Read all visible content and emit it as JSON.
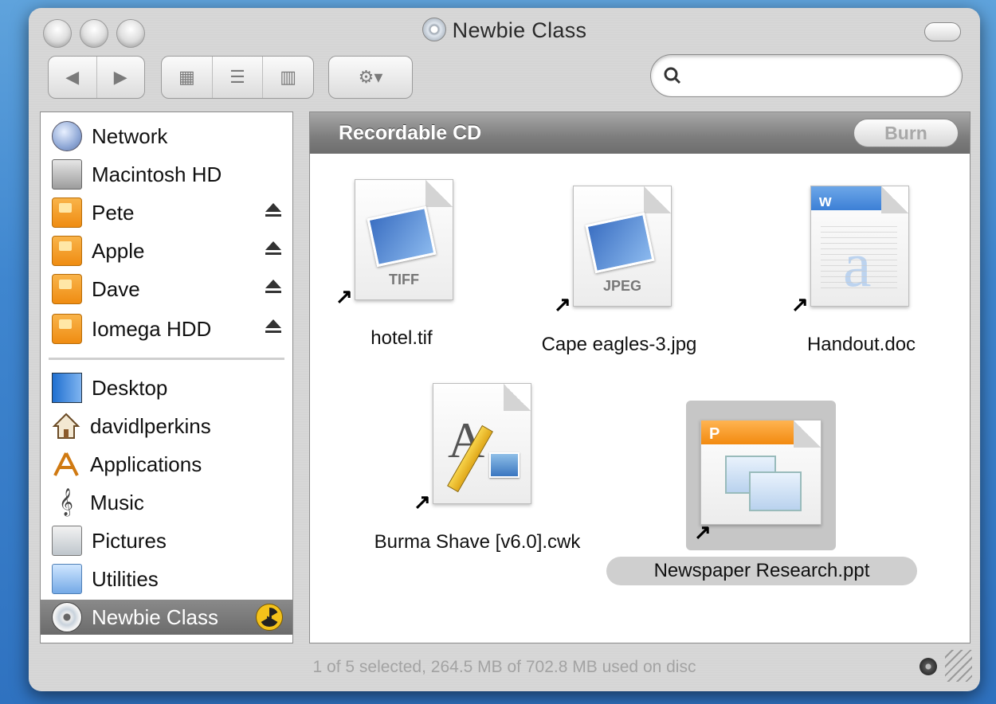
{
  "window": {
    "title": "Newbie Class"
  },
  "toolbar": {
    "back_glyph": "◀",
    "forward_glyph": "▶",
    "view_icon_glyph": "▦",
    "view_list_glyph": "☰",
    "view_column_glyph": "▥",
    "action_glyph": "⚙▾",
    "search_placeholder": ""
  },
  "sidebar": {
    "devices": [
      {
        "label": "Network",
        "icon": "network-globe-icon"
      },
      {
        "label": "Macintosh HD",
        "icon": "hard-disk-icon"
      },
      {
        "label": "Pete",
        "icon": "shared-drive-icon",
        "eject": true
      },
      {
        "label": "Apple",
        "icon": "shared-drive-icon",
        "eject": true
      },
      {
        "label": "Dave",
        "icon": "shared-drive-icon",
        "eject": true
      },
      {
        "label": "Iomega HDD",
        "icon": "shared-drive-icon",
        "eject": true
      }
    ],
    "places": [
      {
        "label": "Desktop",
        "icon": "desktop-icon"
      },
      {
        "label": "davidlperkins",
        "icon": "home-icon"
      },
      {
        "label": "Applications",
        "icon": "applications-icon"
      },
      {
        "label": "Music",
        "icon": "music-icon"
      },
      {
        "label": "Pictures",
        "icon": "pictures-icon"
      },
      {
        "label": "Utilities",
        "icon": "utilities-folder-icon"
      },
      {
        "label": "Newbie Class",
        "icon": "cd-disc-icon",
        "selected": true,
        "burn_icon": "burn-radiation-icon"
      }
    ]
  },
  "main": {
    "header_title": "Recordable CD",
    "burn_button": "Burn",
    "files": [
      {
        "name": "hotel.tif",
        "type_label": "TIFF",
        "icon": "image-document-icon",
        "alias": true
      },
      {
        "name": "Cape eagles-3.jpg",
        "type_label": "JPEG",
        "icon": "image-document-icon",
        "alias": true
      },
      {
        "name": "Handout.doc",
        "type_label": "",
        "icon": "word-document-icon",
        "alias": true
      },
      {
        "name": "Burma Shave [v6.0].cwk",
        "type_label": "",
        "icon": "appleworks-document-icon",
        "alias": true
      },
      {
        "name": "Newspaper Research.ppt",
        "type_label": "",
        "icon": "powerpoint-document-icon",
        "alias": true,
        "selected": true
      }
    ]
  },
  "status": {
    "text": "1 of 5 selected, 264.5 MB of 702.8 MB used on disc"
  }
}
